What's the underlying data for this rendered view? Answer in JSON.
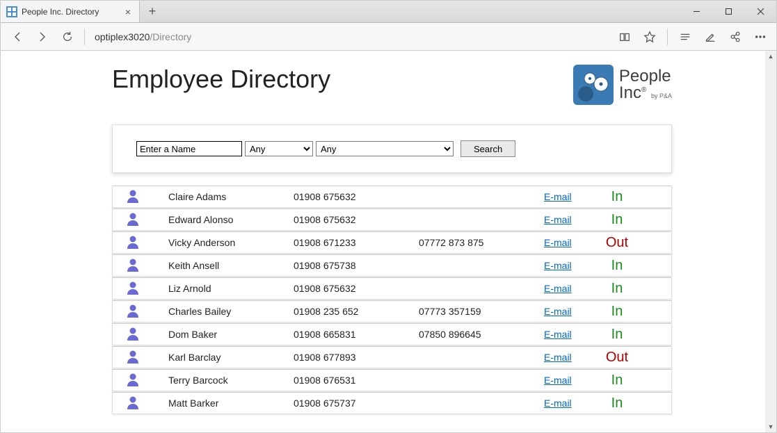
{
  "browser": {
    "tab_title": "People Inc. Directory",
    "url_host": "optiplex3020",
    "url_path": "/Directory"
  },
  "page": {
    "title": "Employee Directory",
    "logo": {
      "line1": "People",
      "line2": "Inc",
      "reg": "®",
      "by": "by P&A"
    }
  },
  "search": {
    "name_placeholder": "Enter a Name",
    "filter1": "Any",
    "filter2": "Any",
    "button": "Search"
  },
  "email_label": "E-mail",
  "status_labels": {
    "in": "In",
    "out": "Out"
  },
  "rows": [
    {
      "name": "Claire Adams",
      "phone": "01908 675632",
      "mobile": "",
      "status": "in"
    },
    {
      "name": "Edward Alonso",
      "phone": "01908 675632",
      "mobile": "",
      "status": "in"
    },
    {
      "name": "Vicky Anderson",
      "phone": "01908 671233",
      "mobile": "07772 873 875",
      "status": "out"
    },
    {
      "name": "Keith Ansell",
      "phone": "01908 675738",
      "mobile": "",
      "status": "in"
    },
    {
      "name": "Liz Arnold",
      "phone": "01908 675632",
      "mobile": "",
      "status": "in"
    },
    {
      "name": "Charles Bailey",
      "phone": "01908 235 652",
      "mobile": "07773 357159",
      "status": "in"
    },
    {
      "name": "Dom Baker",
      "phone": "01908 665831",
      "mobile": "07850 896645",
      "status": "in"
    },
    {
      "name": "Karl Barclay",
      "phone": "01908 677893",
      "mobile": "",
      "status": "out"
    },
    {
      "name": "Terry Barcock",
      "phone": "01908 676531",
      "mobile": "",
      "status": "in"
    },
    {
      "name": "Matt Barker",
      "phone": "01908 675737",
      "mobile": "",
      "status": "in"
    }
  ]
}
